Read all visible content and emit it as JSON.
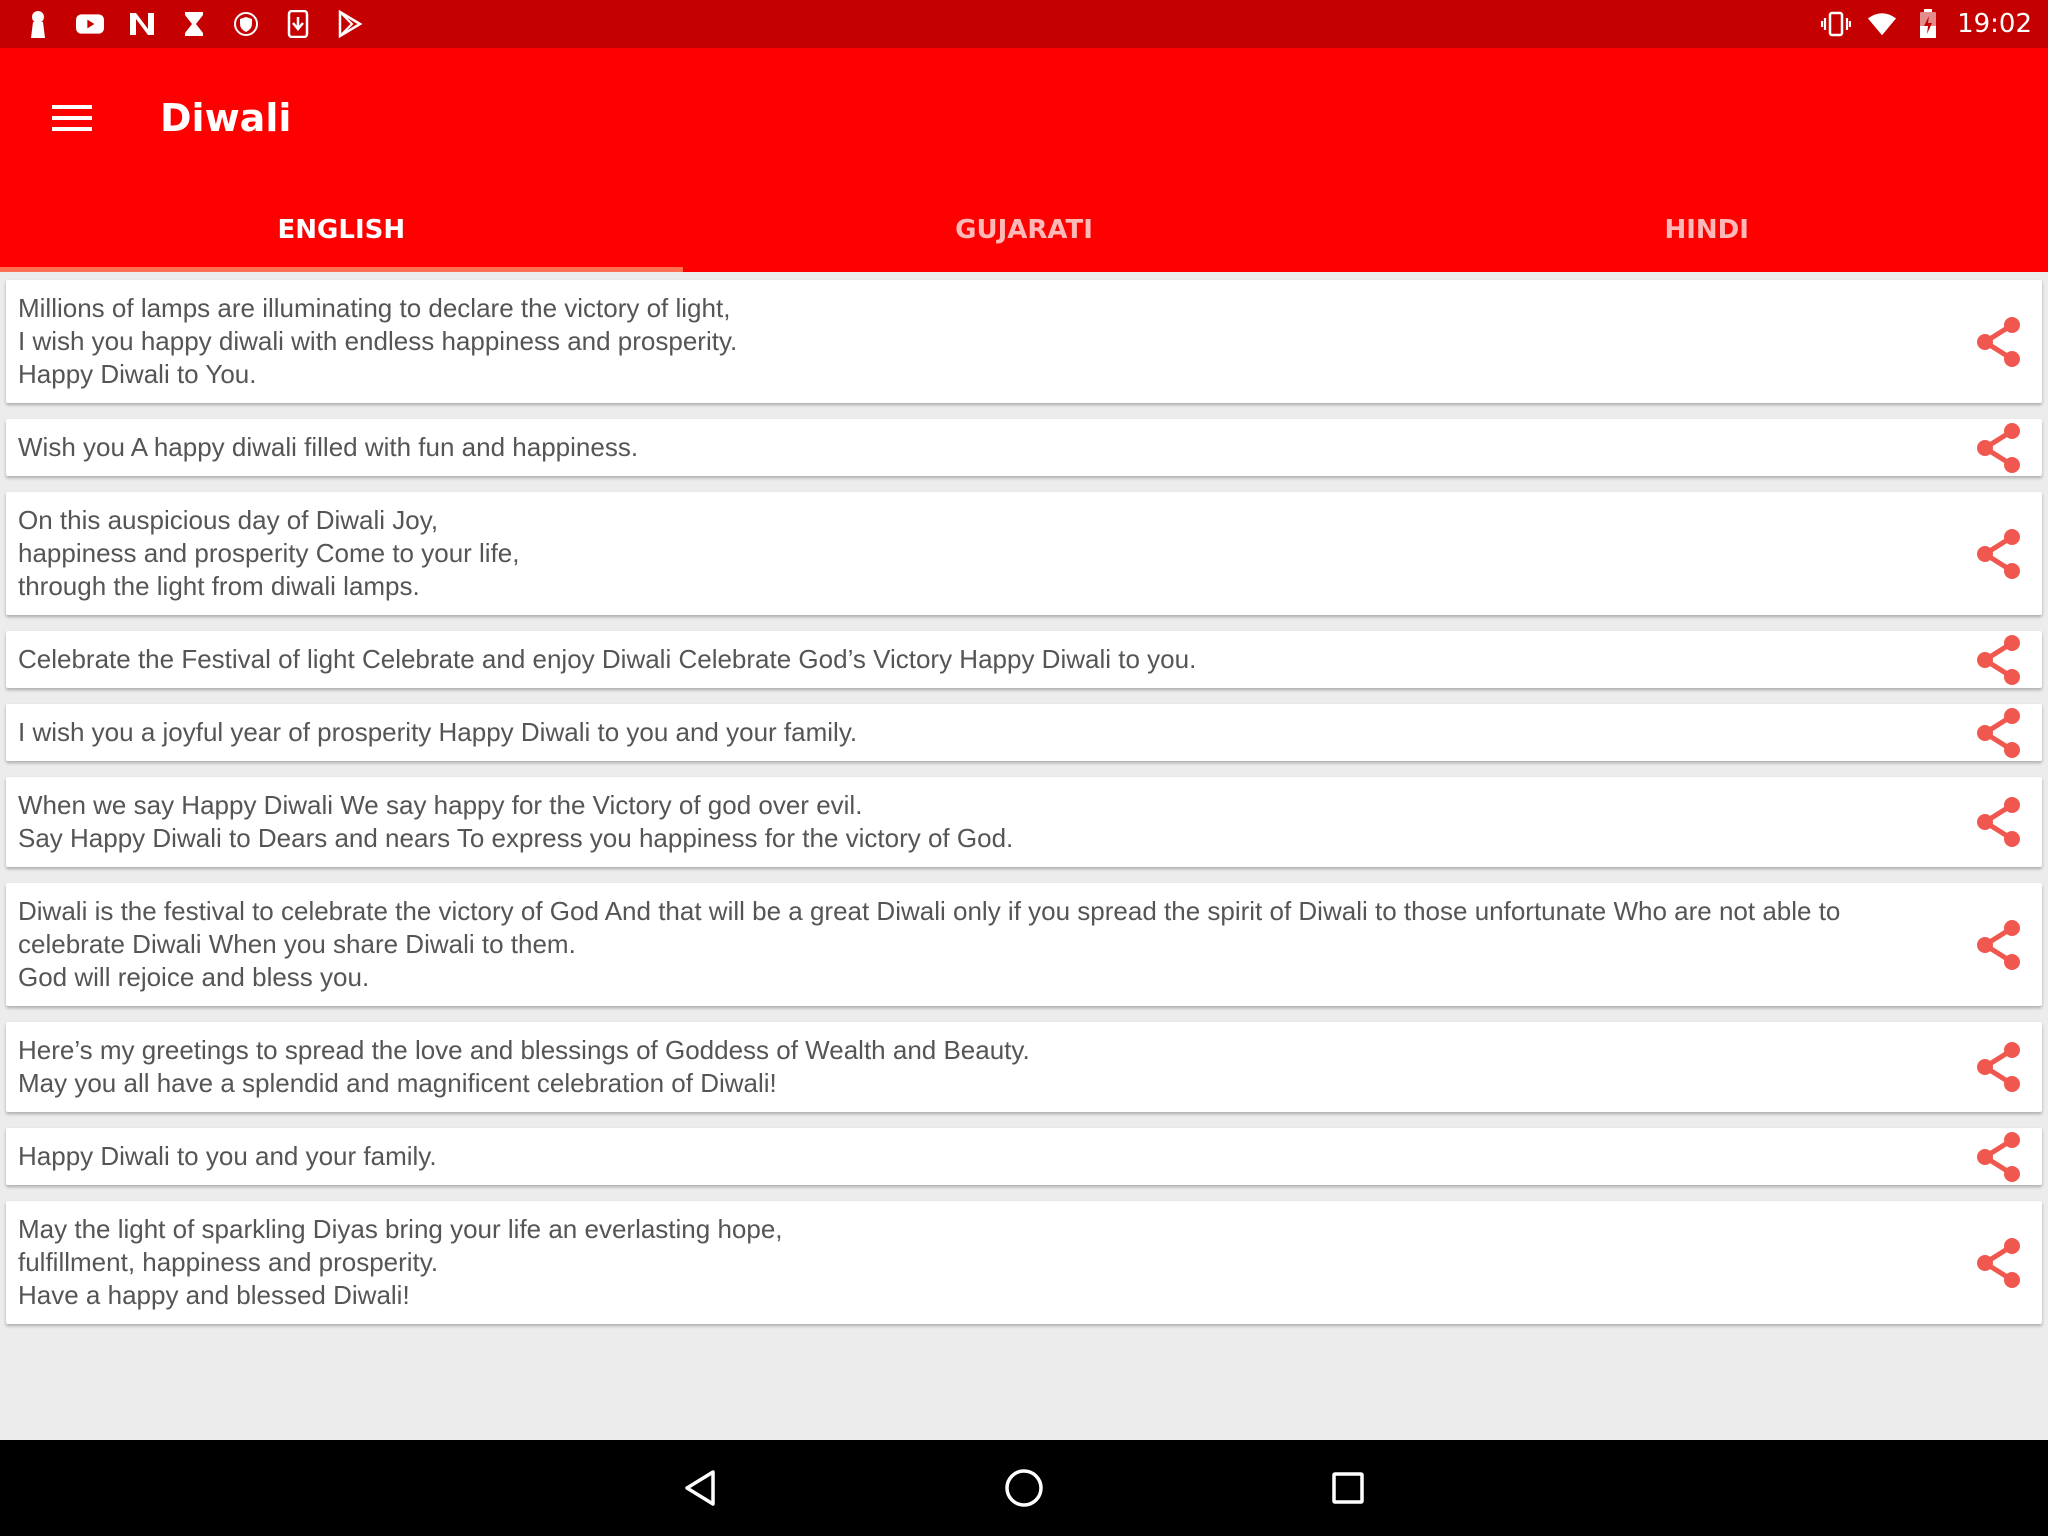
{
  "status_bar": {
    "left_icons": [
      "keyhole-icon",
      "youtube-icon",
      "news-icon",
      "hourglass-icon",
      "shield-icon",
      "download-icon",
      "play-store-icon"
    ],
    "right_icons": [
      "vibrate-icon",
      "wifi-icon",
      "battery-charging-icon"
    ],
    "time": "19:02"
  },
  "app_bar": {
    "title": "Diwali",
    "menu_icon": "menu-icon"
  },
  "tabs": [
    {
      "label": "ENGLISH",
      "active": true
    },
    {
      "label": "GUJARATI",
      "active": false
    },
    {
      "label": "HINDI",
      "active": false
    }
  ],
  "messages": [
    {
      "text": "Millions of lamps are illuminating to declare the victory of light,\nI wish you happy diwali with endless happiness and prosperity.\nHappy Diwali to You."
    },
    {
      "text": "Wish you A happy diwali filled with fun and happiness."
    },
    {
      "text": "On this auspicious day of Diwali Joy,\nhappiness and prosperity Come to your life,\nthrough the light from diwali lamps."
    },
    {
      "text": "Celebrate the Festival of light Celebrate and enjoy Diwali Celebrate God’s Victory Happy Diwali to you."
    },
    {
      "text": "I wish you a joyful year of prosperity Happy Diwali to you and your family."
    },
    {
      "text": "When we say Happy Diwali We say happy for the Victory of god over evil.\nSay Happy Diwali to Dears and nears To express you happiness for the victory of God."
    },
    {
      "text": "Diwali is the festival to celebrate the victory of God And that will be a great Diwali only if you spread the spirit of Diwali to those unfortunate Who are not able to celebrate Diwali When you share Diwali to them.\nGod will rejoice and bless you."
    },
    {
      "text": "Here’s my greetings to spread the love and blessings of Goddess of Wealth and Beauty.\nMay you all have a splendid and magnificent celebration of Diwali!"
    },
    {
      "text": "Happy Diwali to you and your family."
    },
    {
      "text": "May the light of sparkling Diyas bring your life an everlasting hope,\nfulfillment, happiness and prosperity.\nHave a happy and blessed Diwali!"
    }
  ],
  "share_icon": "share-icon",
  "colors": {
    "status_bar": "#c40000",
    "app_bar": "#ff0000",
    "tab_indicator": "#ff6f52",
    "share_icon": "#f0584f",
    "text": "#555555"
  },
  "nav_bar": {
    "icons": [
      "back-icon",
      "home-icon",
      "recents-icon"
    ]
  }
}
